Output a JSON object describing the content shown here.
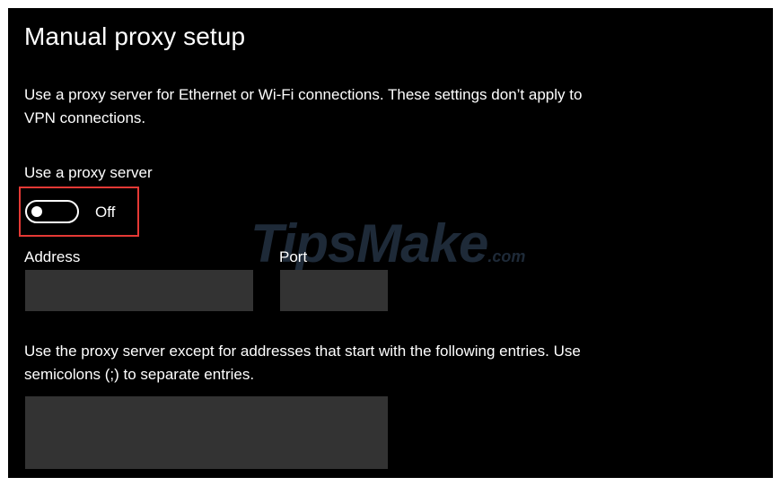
{
  "header": {
    "title": "Manual proxy setup"
  },
  "description": "Use a proxy server for Ethernet or Wi-Fi connections. These settings don’t apply to VPN connections.",
  "proxy_toggle": {
    "label": "Use a proxy server",
    "state_label": "Off",
    "on": false
  },
  "address": {
    "label": "Address",
    "value": "",
    "placeholder": ""
  },
  "port": {
    "label": "Port",
    "value": "",
    "placeholder": ""
  },
  "exceptions": {
    "text": "Use the proxy server except for addresses that start with the following entries. Use semicolons (;) to separate entries.",
    "value": ""
  },
  "watermark": {
    "text": "TipsMake",
    "suffix": ".com"
  },
  "colors": {
    "background": "#000000",
    "text": "#ffffff",
    "field": "#333333",
    "highlight": "#e53935"
  }
}
